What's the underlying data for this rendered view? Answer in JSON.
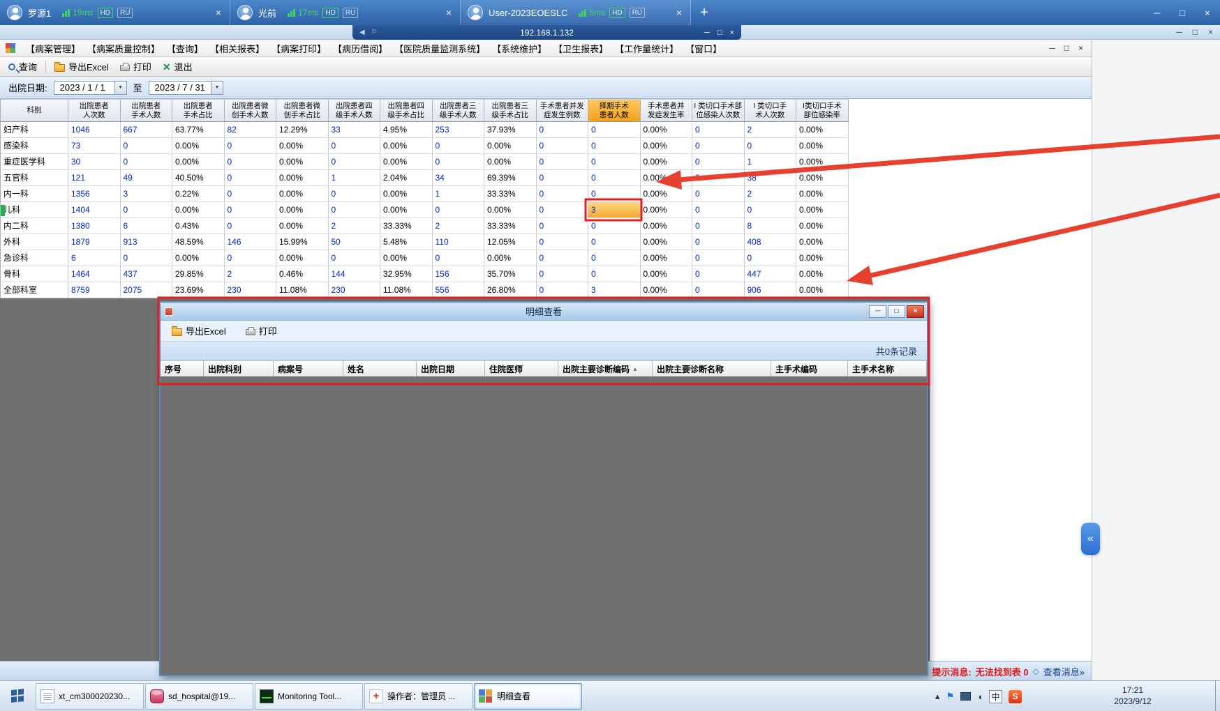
{
  "client": {
    "tabs": [
      {
        "name": "罗源1",
        "latency": "19ms",
        "hd": "HD",
        "ru": "RU"
      },
      {
        "name": "光前",
        "latency": "17ms",
        "hd": "HD",
        "ru": "RU"
      },
      {
        "name": "User-2023EOESLC",
        "latency": "5ms",
        "hd": "HD",
        "ru": "RU"
      }
    ],
    "active_tab": 2,
    "new_tab_glyph": "+",
    "close_glyph": "×",
    "window_controls": {
      "minimize": "─",
      "maximize": "□",
      "close": "×"
    }
  },
  "remote_bar": {
    "address": "192.168.1.132",
    "collapse_glyph": "◀",
    "pin_glyph": "⚐",
    "controls": {
      "minimize": "─",
      "restore": "□",
      "close": "×"
    }
  },
  "menu": {
    "items": [
      "【病案管理】",
      "【病案质量控制】",
      "【查询】",
      "【相关报表】",
      "【病案打印】",
      "【病历借阅】",
      "【医院质量监测系统】",
      "【系统维护】",
      "【卫生报表】",
      "【工作量统计】",
      "【窗口】"
    ],
    "window_controls": {
      "minimize": "─",
      "restore": "□",
      "close": "×"
    }
  },
  "toolbar": {
    "search": "查询",
    "export": "导出Excel",
    "print": "打印",
    "exit": "退出"
  },
  "filter": {
    "label": "出院日期:",
    "from": "2023 / 1 / 1",
    "joiner": "至",
    "to": "2023 / 7 / 31",
    "dropdown_glyph": "▼"
  },
  "table": {
    "columns": [
      "科别",
      "出院患者\n人次数",
      "出院患者\n手术人数",
      "出院患者\n手术占比",
      "出院患者微\n创手术人数",
      "出院患者微\n创手术占比",
      "出院患者四\n级手术人数",
      "出院患者四\n级手术占比",
      "出院患者三\n级手术人数",
      "出院患者三\n级手术占比",
      "手术患者并发\n症发生例数",
      "择期手术\n患者人数",
      "手术患者并\n发症发生率",
      "I 类切口手术部\n位感染人次数",
      "I 类切口手\n术人次数",
      "I类切口手术\n部位感染率"
    ],
    "highlight_column": 11,
    "highlight_cell": {
      "row": 5,
      "col": 11
    },
    "rows": [
      [
        "妇产科",
        "1046",
        "667",
        "63.77%",
        "82",
        "12.29%",
        "33",
        "4.95%",
        "253",
        "37.93%",
        "0",
        "0",
        "0.00%",
        "0",
        "2",
        "0.00%"
      ],
      [
        "感染科",
        "73",
        "0",
        "0.00%",
        "0",
        "0.00%",
        "0",
        "0.00%",
        "0",
        "0.00%",
        "0",
        "0",
        "0.00%",
        "0",
        "0",
        "0.00%"
      ],
      [
        "重症医学科",
        "30",
        "0",
        "0.00%",
        "0",
        "0.00%",
        "0",
        "0.00%",
        "0",
        "0.00%",
        "0",
        "0",
        "0.00%",
        "0",
        "1",
        "0.00%"
      ],
      [
        "五官科",
        "121",
        "49",
        "40.50%",
        "0",
        "0.00%",
        "1",
        "2.04%",
        "34",
        "69.39%",
        "0",
        "0",
        "0.00%",
        "0",
        "38",
        "0.00%"
      ],
      [
        "内一科",
        "1356",
        "3",
        "0.22%",
        "0",
        "0.00%",
        "0",
        "0.00%",
        "1",
        "33.33%",
        "0",
        "0",
        "0.00%",
        "0",
        "2",
        "0.00%"
      ],
      [
        "儿科",
        "1404",
        "0",
        "0.00%",
        "0",
        "0.00%",
        "0",
        "0.00%",
        "0",
        "0.00%",
        "0",
        "3",
        "0.00%",
        "0",
        "0",
        "0.00%"
      ],
      [
        "内二科",
        "1380",
        "6",
        "0.43%",
        "0",
        "0.00%",
        "2",
        "33.33%",
        "2",
        "33.33%",
        "0",
        "0",
        "0.00%",
        "0",
        "8",
        "0.00%"
      ],
      [
        "外科",
        "1879",
        "913",
        "48.59%",
        "146",
        "15.99%",
        "50",
        "5.48%",
        "110",
        "12.05%",
        "0",
        "0",
        "0.00%",
        "0",
        "408",
        "0.00%"
      ],
      [
        "急诊科",
        "6",
        "0",
        "0.00%",
        "0",
        "0.00%",
        "0",
        "0.00%",
        "0",
        "0.00%",
        "0",
        "0",
        "0.00%",
        "0",
        "0",
        "0.00%"
      ],
      [
        "骨科",
        "1464",
        "437",
        "29.85%",
        "2",
        "0.46%",
        "144",
        "32.95%",
        "156",
        "35.70%",
        "0",
        "0",
        "0.00%",
        "0",
        "447",
        "0.00%"
      ],
      [
        "全部科室",
        "8759",
        "2075",
        "23.69%",
        "230",
        "11.08%",
        "230",
        "11.08%",
        "556",
        "26.80%",
        "0",
        "3",
        "0.00%",
        "0",
        "906",
        "0.00%"
      ]
    ]
  },
  "popup": {
    "title": "明细查看",
    "controls": {
      "minimize": "─",
      "maximize": "□",
      "close": "×"
    },
    "toolbar": {
      "export": "导出Excel",
      "print": "打印"
    },
    "record_count": "共0条记录",
    "columns": [
      "序号",
      "出院科别",
      "病案号",
      "姓名",
      "出院日期",
      "住院医师",
      "出院主要诊断编码",
      "出院主要诊断名称",
      "主手术编码",
      "主手术名称"
    ],
    "sort_column_index": 6,
    "sort_glyph": "▲"
  },
  "status": {
    "label": "提示消息:",
    "message": "无法找到表 0",
    "icon_glyph": "◇",
    "link": "查看消息»"
  },
  "taskbar": {
    "items": [
      {
        "label": "xt_cm300020230...",
        "icon": "document",
        "active": false
      },
      {
        "label": "sd_hospital@19...",
        "icon": "database",
        "active": false
      },
      {
        "label": "Monitoring Tool...",
        "icon": "monitor",
        "active": false
      },
      {
        "label": "操作者：管理员 ...",
        "icon": "medical",
        "active": false
      },
      {
        "label": "明细查看",
        "icon": "window",
        "active": true
      }
    ],
    "tray": {
      "expand_glyph": "▴",
      "flag_glyph": "⚑",
      "speaker_glyph": "◖",
      "ime": "中",
      "sogou": "S"
    },
    "clock": {
      "time": "17:21",
      "date": "2023/9/12"
    }
  },
  "side_toggle_glyph": "«",
  "colors": {
    "highlight_orange": "#f5a832",
    "annotation_red": "#e8402e",
    "latency_green": "#43d364",
    "number_blue": "#0026c4"
  }
}
